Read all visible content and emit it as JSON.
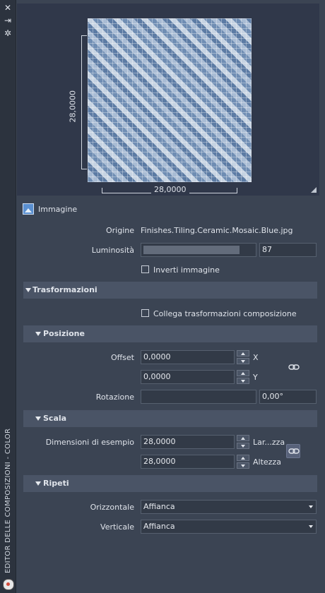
{
  "sidebar": {
    "title": "EDITOR DELLE COMPOSIZIONI - COLOR",
    "icons": [
      "close-icon",
      "pin-icon",
      "settings-icon",
      "app-icon"
    ]
  },
  "preview": {
    "width_label": "28,0000",
    "height_label": "28,0000"
  },
  "image": {
    "section_label": "Immagine",
    "origin_label": "Origine",
    "origin_value": "Finishes.Tiling.Ceramic.Mosaic.Blue.jpg",
    "brightness_label": "Luminosità",
    "brightness_value": "87",
    "brightness_fraction": 0.87,
    "invert_label": "Inverti immagine",
    "invert_checked": false
  },
  "transforms": {
    "title": "Trasformazioni",
    "link_label": "Collega trasformazioni composizione",
    "link_checked": false,
    "position": {
      "title": "Posizione",
      "offset_label": "Offset",
      "offset_x": "0,0000",
      "offset_y": "0,0000",
      "x_label": "X",
      "y_label": "Y",
      "rotation_label": "Rotazione",
      "rotation_value": "0,00°"
    },
    "scale": {
      "title": "Scala",
      "sample_size_label": "Dimensioni di esempio",
      "width_value": "28,0000",
      "height_value": "28,0000",
      "width_label": "Lar...zza",
      "height_label": "Altezza"
    },
    "repeat": {
      "title": "Ripeti",
      "horizontal_label": "Orizzontale",
      "horizontal_value": "Affianca",
      "vertical_label": "Verticale",
      "vertical_value": "Affianca"
    }
  }
}
